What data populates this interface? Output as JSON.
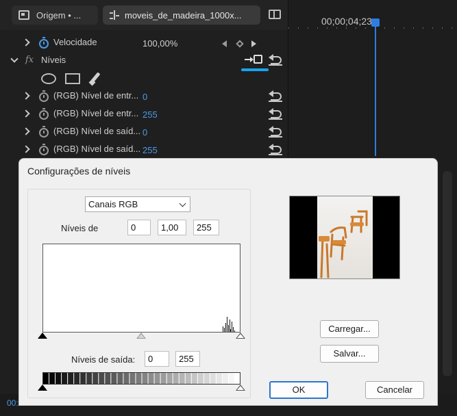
{
  "tabs": {
    "tab1_label": "Origem • ...",
    "tab2_label": "moveis_de_madeira_1000x...",
    "tab2_suffix": "▴"
  },
  "timeline": {
    "timecode": "00;00;04;23",
    "bottom_timecode": "00:",
    "playhead_color": "#2f7de0"
  },
  "effect_controls": {
    "velocidade_label": "Velocidade",
    "velocidade_value": "100,00%",
    "fx_symbol": "fx",
    "niveis_label": "Níveis",
    "params": [
      {
        "label": "(RGB) Nível de entr...",
        "value": "0"
      },
      {
        "label": "(RGB) Nível de entr...",
        "value": "255"
      },
      {
        "label": "(RGB) Nível de saíd...",
        "value": "0"
      },
      {
        "label": "(RGB) Nível de saíd...",
        "value": "255"
      }
    ],
    "value_color": "#4a9be8",
    "highlight_color": "#1aa3f0"
  },
  "dialog": {
    "title": "Configurações de níveis",
    "channel_select": "Canais RGB",
    "input_levels_label": "Níveis de",
    "input_black": "0",
    "input_gamma": "1,00",
    "input_white": "255",
    "output_levels_label": "Níveis de saída:",
    "output_black": "0",
    "output_white": "255",
    "load_button": "Carregar...",
    "save_button": "Salvar...",
    "ok_button": "OK",
    "cancel_button": "Cancelar"
  }
}
